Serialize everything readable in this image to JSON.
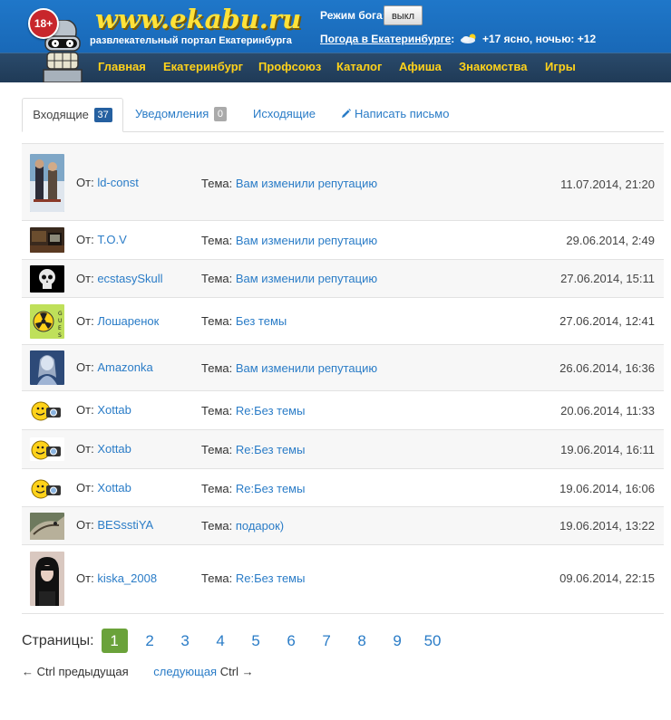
{
  "header": {
    "age_badge": "18+",
    "logo": "www.ekabu.ru",
    "slogan": "развлекательный портал Екатеринбурга",
    "god_mode_label": "Режим бога:",
    "god_mode_button": "выкл",
    "weather_link": "Погода в Екатеринбурге",
    "weather_sep": ":",
    "weather_text": "+17 ясно, ночью: +12",
    "nav": [
      "Главная",
      "Екатеринбург",
      "Профсоюз",
      "Каталог",
      "Афиша",
      "Знакомства",
      "Игры"
    ]
  },
  "tabs": {
    "inbox": {
      "label": "Входящие",
      "count": "37"
    },
    "notifications": {
      "label": "Уведомления",
      "count": "0"
    },
    "outbox": {
      "label": "Исходящие"
    },
    "compose": {
      "label": "Написать письмо"
    }
  },
  "labels": {
    "from": "От:",
    "subject": "Тема:"
  },
  "messages": [
    {
      "from": "ld-const",
      "subject": "Вам изменили репутацию",
      "date": "11.07.2014, 21:20",
      "avatar": "photo-people"
    },
    {
      "from": "T.O.V",
      "subject": "Вам изменили репутацию",
      "date": "29.06.2014, 2:49",
      "avatar": "photo-room"
    },
    {
      "from": "ecstasySkull",
      "subject": "Вам изменили репутацию",
      "date": "27.06.2014, 15:11",
      "avatar": "skull"
    },
    {
      "from": "Лошаренок",
      "subject": "Без темы",
      "date": "27.06.2014, 12:41",
      "avatar": "guest-radiation"
    },
    {
      "from": "Amazonka",
      "subject": "Вам изменили репутацию",
      "date": "26.06.2014, 16:36",
      "avatar": "photo-blue"
    },
    {
      "from": "Xottab",
      "subject": "Re:Без темы",
      "date": "20.06.2014, 11:33",
      "avatar": "smiley-camera"
    },
    {
      "from": "Xottab",
      "subject": "Re:Без темы",
      "date": "19.06.2014, 16:11",
      "avatar": "smiley-camera"
    },
    {
      "from": "Xottab",
      "subject": "Re:Без темы",
      "date": "19.06.2014, 16:06",
      "avatar": "smiley-camera"
    },
    {
      "from": "BESsstiYA",
      "subject": "подарок)",
      "date": "19.06.2014, 13:22",
      "avatar": "photo-animal"
    },
    {
      "from": "kiska_2008",
      "subject": "Re:Без темы",
      "date": "09.06.2014, 22:15",
      "avatar": "photo-girl"
    }
  ],
  "pagination": {
    "label": "Страницы:",
    "pages": [
      "1",
      "2",
      "3",
      "4",
      "5",
      "6",
      "7",
      "8",
      "9",
      "50"
    ],
    "current": "1",
    "prev": "← Ctrl предыдущая",
    "next": "следующая",
    "next_suffix": "Ctrl →"
  }
}
